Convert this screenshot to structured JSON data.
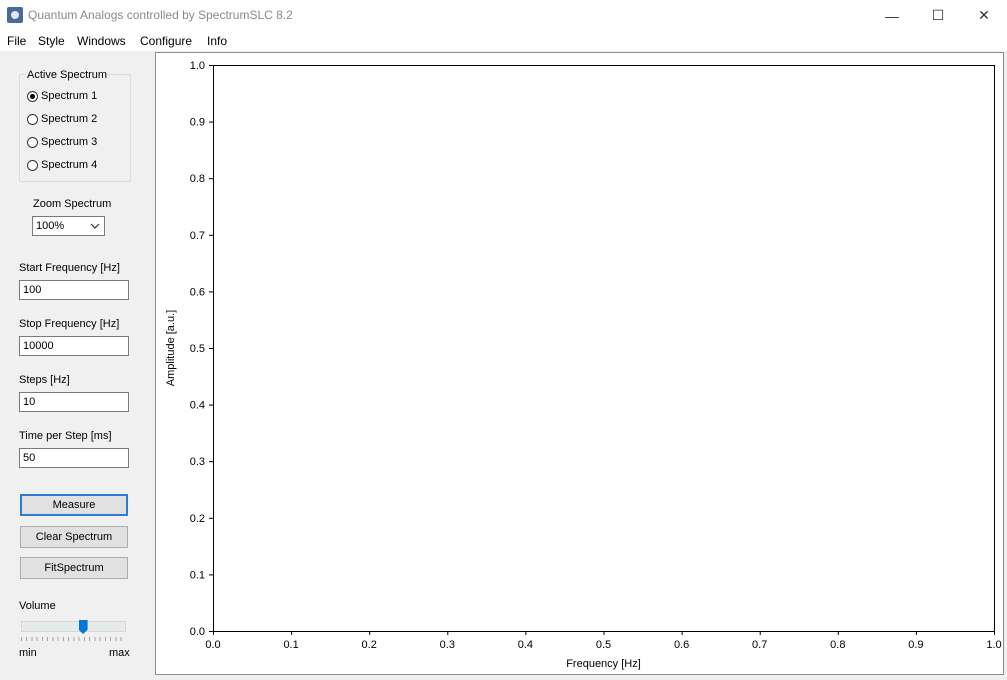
{
  "window": {
    "title": "Quantum Analogs controlled by SpectrumSLC  8.2",
    "controls": [
      "—",
      "☐",
      "✕"
    ]
  },
  "menu": [
    "File",
    "Style",
    "Windows",
    "Configure",
    "Info"
  ],
  "active_spectrum": {
    "title": "Active Spectrum",
    "options": [
      "Spectrum 1",
      "Spectrum 2",
      "Spectrum 3",
      "Spectrum 4"
    ],
    "selected": "Spectrum 1"
  },
  "zoom": {
    "label": "Zoom Spectrum",
    "value": "100%",
    "chevron": "⌵"
  },
  "fields": {
    "start_label": "Start Frequency [Hz]",
    "start_value": "100",
    "stop_label": "Stop Frequency [Hz]",
    "stop_value": "10000",
    "steps_label": "Steps [Hz]",
    "steps_value": "10",
    "time_label": "Time per Step [ms]",
    "time_value": "50"
  },
  "buttons": {
    "measure": "Measure",
    "clear": "Clear Spectrum",
    "fit": "FitSpectrum"
  },
  "volume": {
    "label": "Volume",
    "min": "min",
    "max": "max",
    "level": 0.6
  },
  "chart_data": {
    "type": "line",
    "title": "",
    "xlabel": "Frequency [Hz]",
    "ylabel": "Amplitude [a.u.]",
    "xlim": [
      0,
      1
    ],
    "ylim": [
      0,
      1
    ],
    "xticks": [
      "0.0",
      "0.1",
      "0.2",
      "0.3",
      "0.4",
      "0.5",
      "0.6",
      "0.7",
      "0.8",
      "0.9",
      "1.0"
    ],
    "yticks": [
      "0.0",
      "0.1",
      "0.2",
      "0.3",
      "0.4",
      "0.5",
      "0.6",
      "0.7",
      "0.8",
      "0.9",
      "1.0"
    ],
    "series": [],
    "grid": false
  }
}
